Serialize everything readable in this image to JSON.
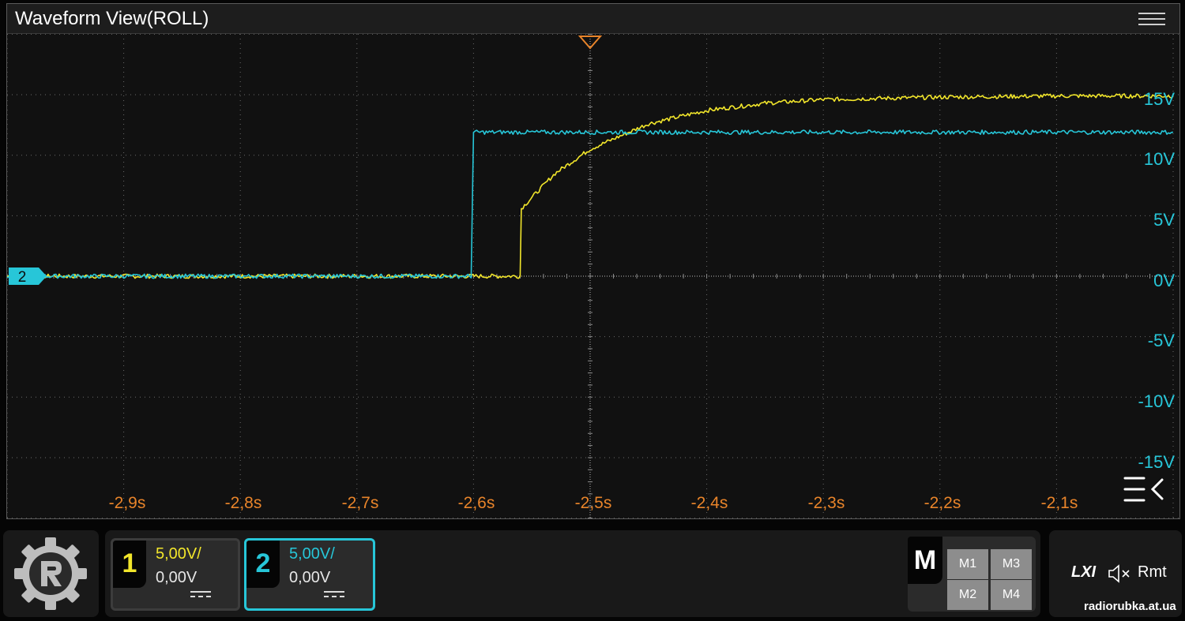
{
  "window": {
    "title": "Waveform View(ROLL)"
  },
  "icons": {
    "menu": "hamburger-menu-icon",
    "trigger": "trigger-position-marker-icon",
    "collapse": "collapse-panel-icon",
    "logo": "gear-logo-icon",
    "speaker": "speaker-muted-icon"
  },
  "colors": {
    "ch1": "#f2e62b",
    "ch2": "#27c6d8",
    "time_axis": "#e8842a",
    "trigger": "#e8842a",
    "grid": "#8a8a8a"
  },
  "y_axis": {
    "labels": [
      "15V",
      "10V",
      "5V",
      "0V",
      "-5V",
      "-10V",
      "-15V"
    ]
  },
  "x_axis": {
    "labels": [
      "-2,9s",
      "-2,8s",
      "-2,7s",
      "-2,6s",
      "-2,5s",
      "-2,4s",
      "-2,3s",
      "-2,2s",
      "-2,1s"
    ]
  },
  "ground_marker": {
    "label": "2"
  },
  "chart_data": {
    "type": "line",
    "xlim": [
      -3.0,
      -2.0
    ],
    "ylim": [
      -20,
      20
    ],
    "x_unit": "s",
    "y_unit": "V",
    "grid": true,
    "series": [
      {
        "channel": "1",
        "color": "#f2e62b",
        "x": [
          -3.0,
          -2.56,
          -2.559,
          -2.53,
          -2.5,
          -2.45,
          -2.4,
          -2.35,
          -2.3,
          -2.2,
          -2.1,
          -2.0
        ],
        "values": [
          0,
          0,
          5.6,
          8.5,
          10.5,
          12.6,
          13.7,
          14.3,
          14.6,
          14.8,
          14.9,
          14.9
        ]
      },
      {
        "channel": "2",
        "color": "#27c6d8",
        "x": [
          -3.0,
          -2.602,
          -2.6,
          -2.0
        ],
        "values": [
          0,
          0,
          11.9,
          11.9
        ]
      }
    ]
  },
  "channels": [
    {
      "number": "1",
      "scale": "5,00V/",
      "offset": "0,00V"
    },
    {
      "number": "2",
      "scale": "5,00V/",
      "offset": "0,00V"
    }
  ],
  "math": {
    "label": "M",
    "buttons": [
      "M1",
      "M3",
      "M2",
      "M4"
    ]
  },
  "status": {
    "lxi": "LXI",
    "rmt": "Rmt"
  },
  "watermark": "radiorubka.at.ua"
}
